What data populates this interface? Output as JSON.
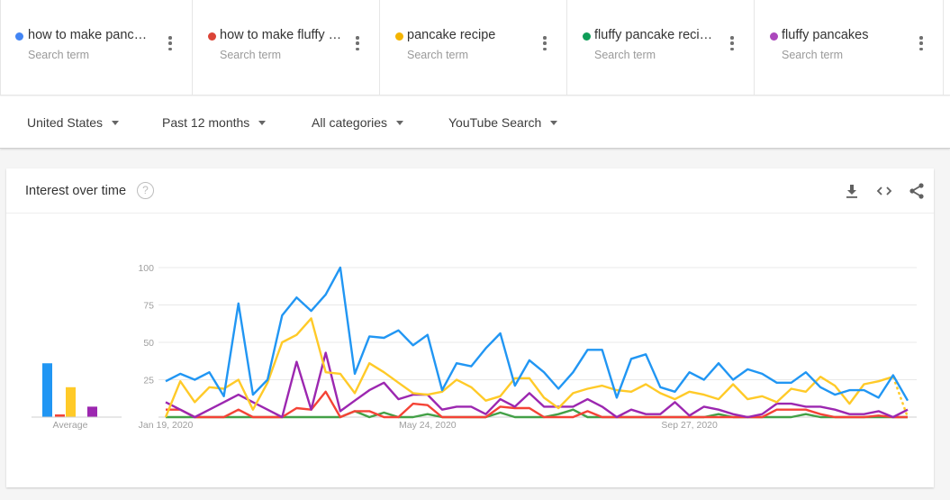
{
  "terms": [
    {
      "name": "how to make panc…",
      "sub": "Search term",
      "color": "#4285f4"
    },
    {
      "name": "how to make fluffy …",
      "sub": "Search term",
      "color": "#db4437"
    },
    {
      "name": "pancake recipe",
      "sub": "Search term",
      "color": "#f4b400"
    },
    {
      "name": "fluffy pancake reci…",
      "sub": "Search term",
      "color": "#0f9d58"
    },
    {
      "name": "fluffy pancakes",
      "sub": "Search term",
      "color": "#ab47bc"
    }
  ],
  "filters": {
    "region": "United States",
    "time": "Past 12 months",
    "category": "All categories",
    "property": "YouTube Search"
  },
  "card": {
    "title": "Interest over time",
    "help_glyph": "?",
    "icons": [
      "download-icon",
      "embed-icon",
      "share-icon"
    ]
  },
  "chart_data": {
    "type": "line",
    "title": "Interest over time",
    "ylim": [
      0,
      100
    ],
    "yticks": [
      25,
      50,
      75,
      100
    ],
    "grid": true,
    "x_tick_labels": [
      {
        "label": "Jan 19, 2020",
        "index": 0
      },
      {
        "label": "May 24, 2020",
        "index": 18
      },
      {
        "label": "Sep 27, 2020",
        "index": 36
      }
    ],
    "series": [
      {
        "name": "how to make pancakes",
        "color": "#2196f3",
        "values": [
          24,
          29,
          25,
          30,
          14,
          76,
          15,
          25,
          68,
          80,
          71,
          82,
          100,
          29,
          54,
          53,
          58,
          48,
          55,
          18,
          36,
          34,
          46,
          56,
          21,
          38,
          30,
          19,
          30,
          45,
          45,
          13,
          39,
          42,
          20,
          17,
          30,
          25,
          36,
          25,
          32,
          29,
          23,
          23,
          30,
          20,
          15,
          18,
          18,
          13,
          28,
          11
        ]
      },
      {
        "name": "how to make fluffy pancakes",
        "color": "#f44336",
        "values": [
          5,
          5,
          0,
          0,
          0,
          5,
          0,
          0,
          0,
          6,
          5,
          17,
          0,
          4,
          4,
          0,
          0,
          9,
          8,
          0,
          0,
          0,
          0,
          7,
          6,
          6,
          0,
          0,
          0,
          4,
          0,
          0,
          0,
          0,
          0,
          0,
          0,
          0,
          0,
          0,
          0,
          0,
          5,
          5,
          5,
          2,
          0,
          0,
          0,
          1,
          0,
          0
        ]
      },
      {
        "name": "pancake recipe",
        "color": "#ffca28",
        "values": [
          0,
          24,
          10,
          20,
          19,
          25,
          5,
          23,
          50,
          55,
          66,
          30,
          29,
          16,
          36,
          30,
          23,
          16,
          15,
          17,
          25,
          20,
          11,
          14,
          26,
          26,
          13,
          6,
          16,
          19,
          21,
          18,
          17,
          22,
          16,
          12,
          17,
          15,
          12,
          22,
          12,
          14,
          10,
          19,
          17,
          27,
          21,
          9,
          22,
          24,
          27,
          0
        ],
        "partial_last": true
      },
      {
        "name": "fluffy pancake recipe",
        "color": "#43a047",
        "values": [
          0,
          0,
          0,
          0,
          0,
          0,
          0,
          0,
          0,
          0,
          0,
          0,
          0,
          4,
          0,
          3,
          0,
          0,
          2,
          0,
          0,
          0,
          0,
          3,
          0,
          0,
          0,
          2,
          5,
          0,
          0,
          0,
          0,
          0,
          0,
          0,
          0,
          0,
          2,
          0,
          0,
          0,
          0,
          0,
          2,
          0,
          0,
          0,
          0,
          0,
          0,
          0
        ]
      },
      {
        "name": "fluffy pancakes",
        "color": "#9c27b0",
        "values": [
          10,
          5,
          0,
          5,
          10,
          15,
          10,
          5,
          0,
          37,
          5,
          43,
          4,
          11,
          18,
          23,
          12,
          15,
          15,
          5,
          7,
          7,
          2,
          12,
          7,
          16,
          7,
          7,
          7,
          12,
          7,
          0,
          5,
          2,
          2,
          10,
          1,
          7,
          5,
          2,
          0,
          2,
          9,
          9,
          7,
          7,
          5,
          2,
          2,
          4,
          0,
          5
        ]
      }
    ],
    "averages": {
      "label": "Average",
      "values": [
        36,
        1,
        20,
        0,
        7
      ],
      "colors": [
        "#2196f3",
        "#f44336",
        "#ffca28",
        "#43a047",
        "#9c27b0"
      ]
    }
  }
}
